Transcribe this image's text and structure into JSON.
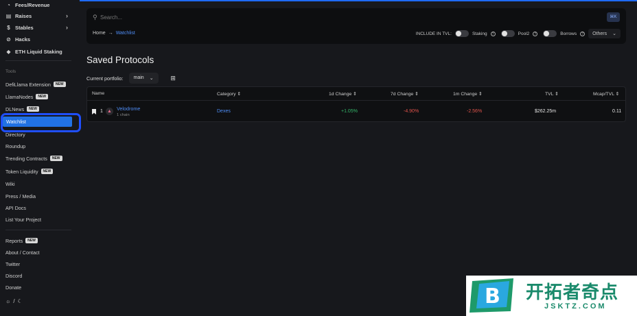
{
  "sidebar": {
    "top_items": [
      {
        "label": "Fees/Revenue",
        "icon": "fees-icon"
      },
      {
        "label": "Raises",
        "icon": "raises-icon",
        "has_chevron": true
      },
      {
        "label": "Stables",
        "icon": "dollar-icon",
        "has_chevron": true
      },
      {
        "label": "Hacks",
        "icon": "hacks-icon"
      },
      {
        "label": "ETH Liquid Staking",
        "icon": "eth-icon"
      }
    ],
    "tools_label": "Tools",
    "tools": [
      {
        "label": "DefiLlama Extension",
        "badge": "NEW"
      },
      {
        "label": "LlamaNodes",
        "badge": "NEW"
      },
      {
        "label": "DLNews",
        "badge": "NEW"
      },
      {
        "label": "Watchlist",
        "active": true
      },
      {
        "label": "Directory"
      },
      {
        "label": "Roundup"
      },
      {
        "label": "Trending Contracts",
        "badge": "NEW"
      },
      {
        "label": "Token Liquidity",
        "badge": "NEW"
      },
      {
        "label": "Wiki"
      },
      {
        "label": "Press / Media"
      },
      {
        "label": "API Docs"
      },
      {
        "label": "List Your Project"
      }
    ],
    "footer": [
      {
        "label": "Reports",
        "badge": "NEW"
      },
      {
        "label": "About / Contact"
      },
      {
        "label": "Twitter"
      },
      {
        "label": "Discord"
      },
      {
        "label": "Donate"
      }
    ],
    "theme_toggle": {
      "light_icon": "sun-icon",
      "separator": "/",
      "dark_icon": "moon-icon"
    }
  },
  "header": {
    "search_placeholder": "Search...",
    "shortcut": "⌘K",
    "breadcrumb": {
      "home": "Home",
      "arrow": "→",
      "current": "Watchlist"
    },
    "include_tvl_label": "INCLUDE IN TVL:",
    "toggles": [
      {
        "label": "Staking",
        "on": false
      },
      {
        "label": "Pool2",
        "on": false
      },
      {
        "label": "Borrows",
        "on": false
      }
    ],
    "others_label": "Others"
  },
  "main": {
    "title": "Saved Protocols",
    "portfolio_label": "Current portfolio:",
    "portfolio_value": "main",
    "table": {
      "columns": [
        "Name",
        "Category",
        "1d Change",
        "7d Change",
        "1m Change",
        "TVL",
        "Mcap/TVL"
      ],
      "rows": [
        {
          "rank": "1",
          "name": "Velodrome",
          "chains": "1 chain",
          "category": "Dexes",
          "change_1d": "+1.05%",
          "change_7d": "-4.90%",
          "change_1m": "-2.56%",
          "tvl": "$262.25m",
          "mcap_tvl": "0.11"
        }
      ]
    }
  },
  "watermark": {
    "title": "开拓者奇点",
    "subtitle": "JSKTZ.COM",
    "logo_letter": "B"
  },
  "colors": {
    "accent": "#2172e5",
    "link": "#4f8df5",
    "positive": "#35b86b",
    "negative": "#e0534b",
    "highlight": "#1f4fff"
  }
}
